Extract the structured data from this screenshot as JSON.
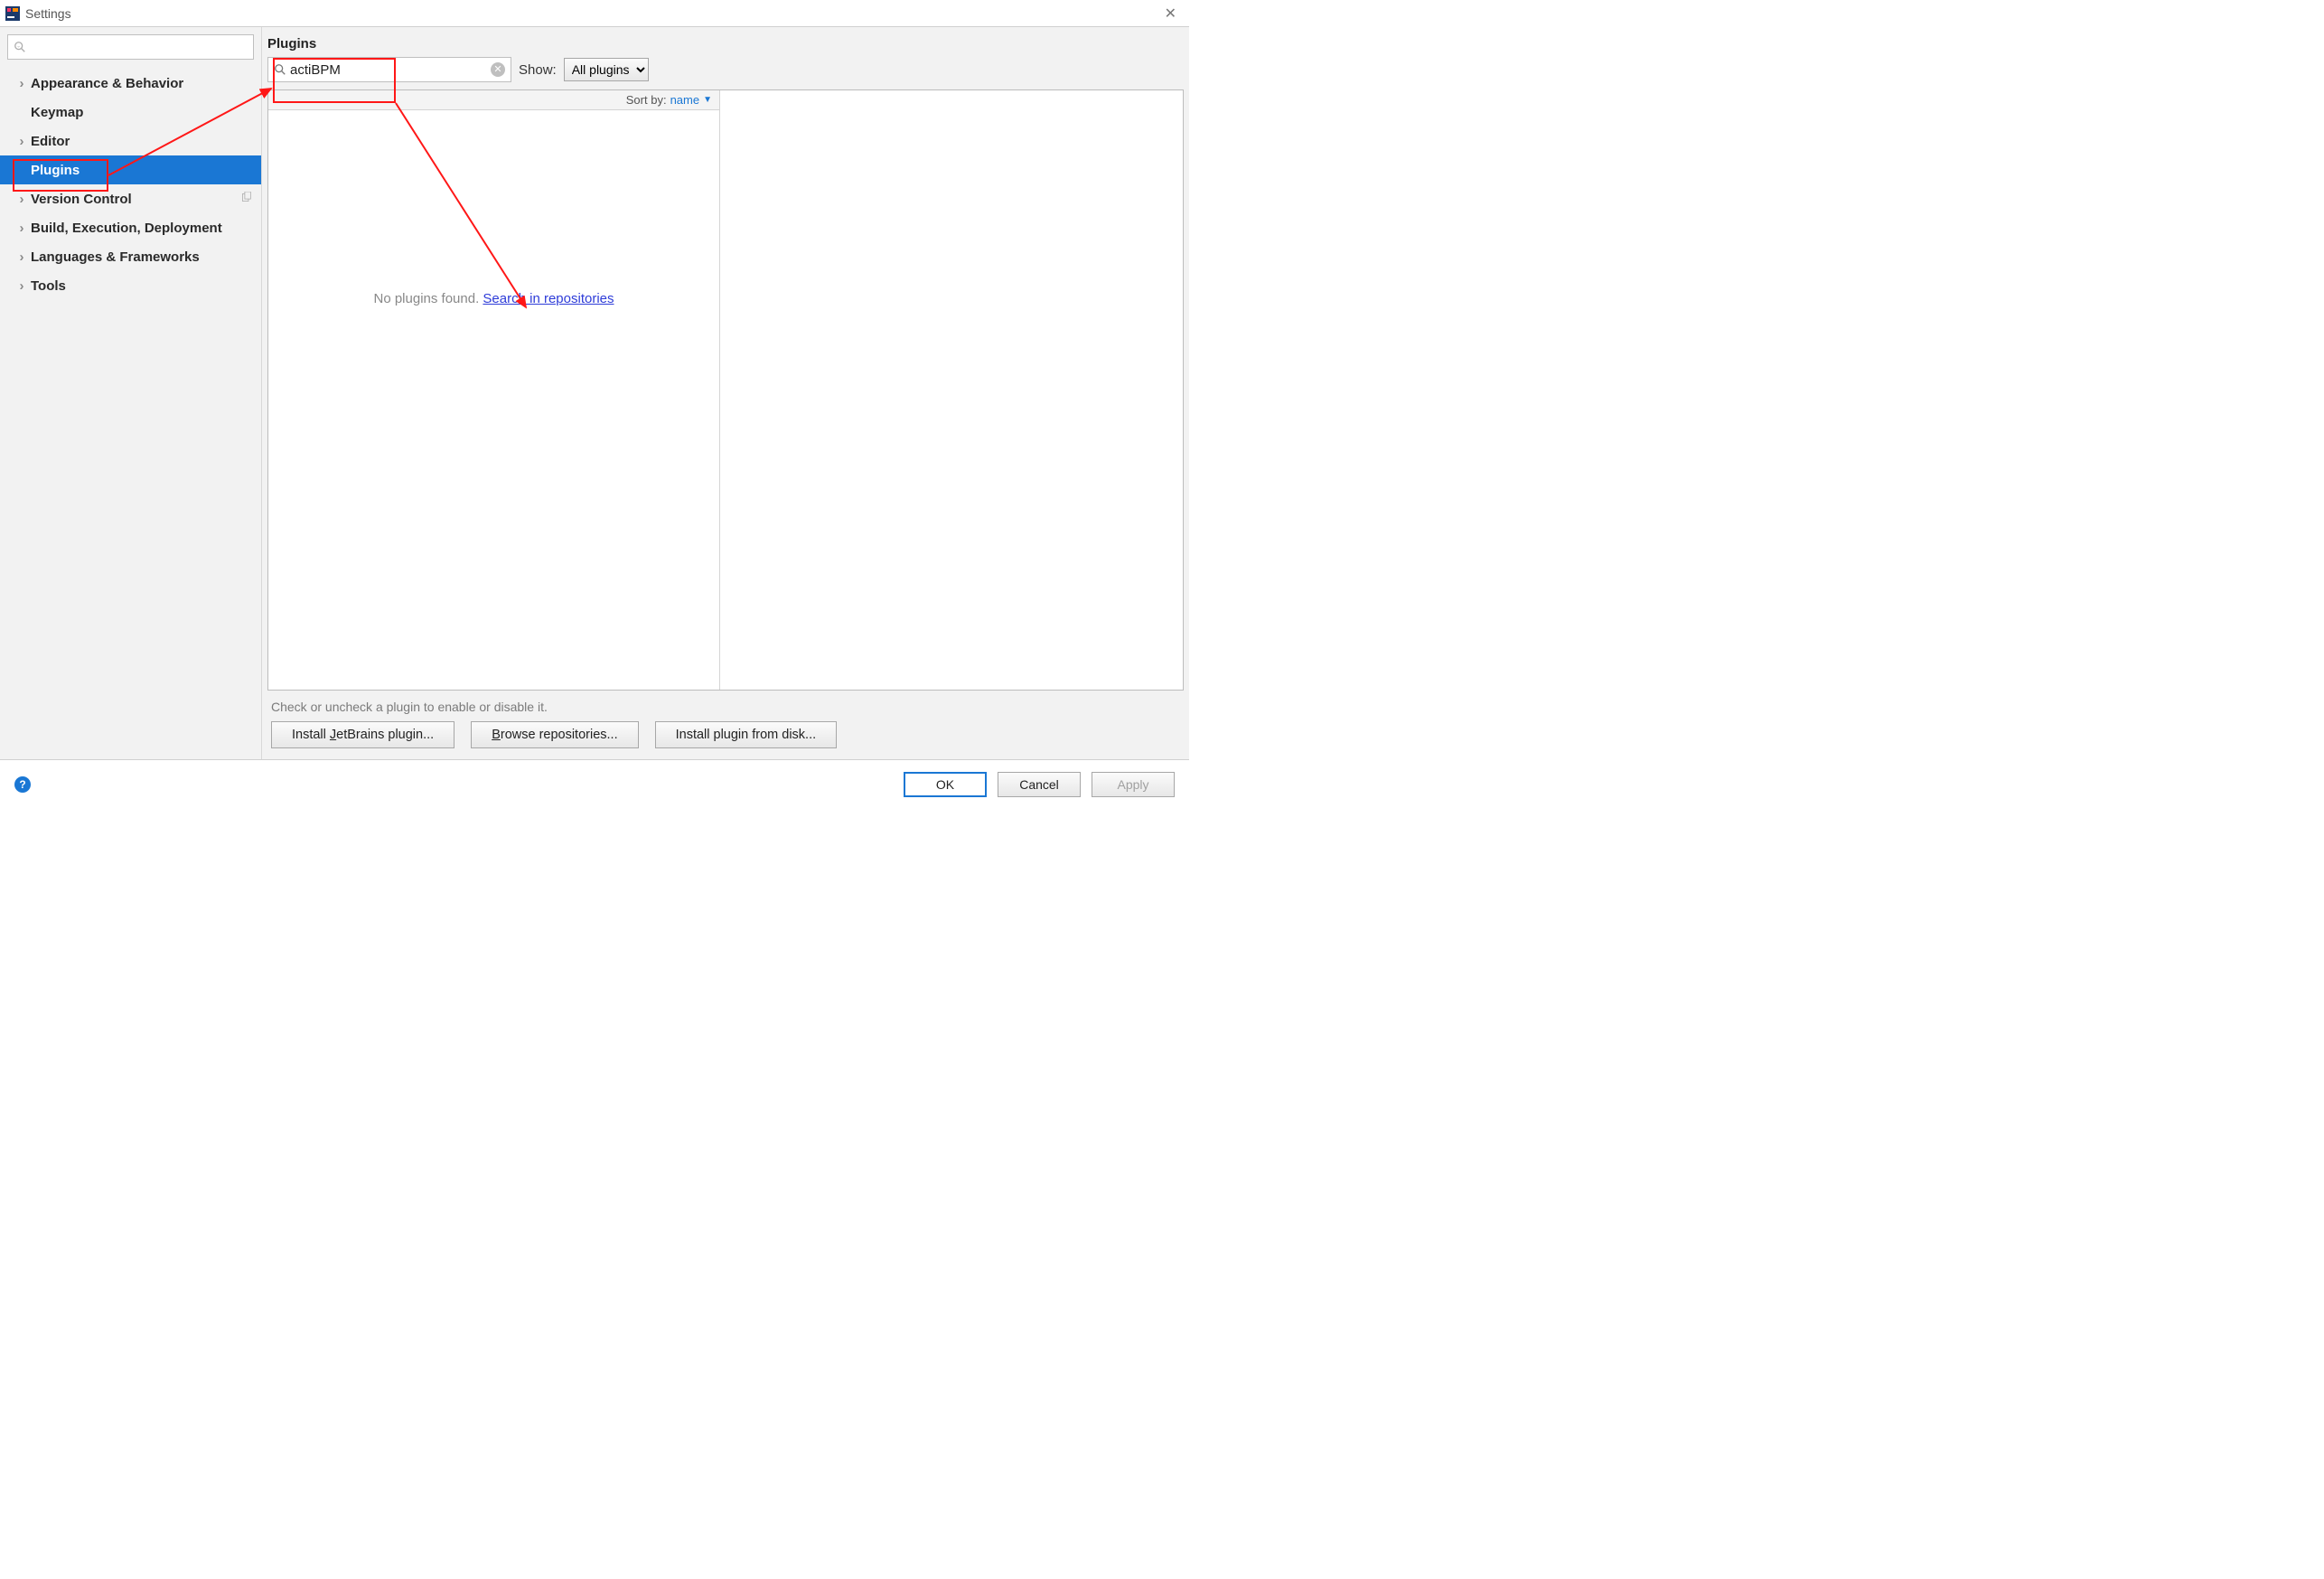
{
  "window": {
    "title": "Settings"
  },
  "sidebar": {
    "search_placeholder": "",
    "items": [
      {
        "label": "Appearance & Behavior",
        "expandable": true
      },
      {
        "label": "Keymap",
        "expandable": false
      },
      {
        "label": "Editor",
        "expandable": true
      },
      {
        "label": "Plugins",
        "expandable": false,
        "selected": true
      },
      {
        "label": "Version Control",
        "expandable": true,
        "has_copy": true
      },
      {
        "label": "Build, Execution, Deployment",
        "expandable": true
      },
      {
        "label": "Languages & Frameworks",
        "expandable": true
      },
      {
        "label": "Tools",
        "expandable": true
      }
    ]
  },
  "main": {
    "title": "Plugins",
    "search_value": "actiBPM",
    "show_label": "Show:",
    "show_options": [
      "All plugins"
    ],
    "show_selected": "All plugins",
    "sort_label": "Sort by:",
    "sort_value": "name",
    "empty_text": "No plugins found.",
    "empty_link": "Search in repositories",
    "hint": "Check or uncheck a plugin to enable or disable it.",
    "buttons": {
      "install_jb": "Install JetBrains plugin...",
      "browse": "Browse repositories...",
      "install_disk": "Install plugin from disk..."
    }
  },
  "footer": {
    "ok": "OK",
    "cancel": "Cancel",
    "apply": "Apply"
  }
}
